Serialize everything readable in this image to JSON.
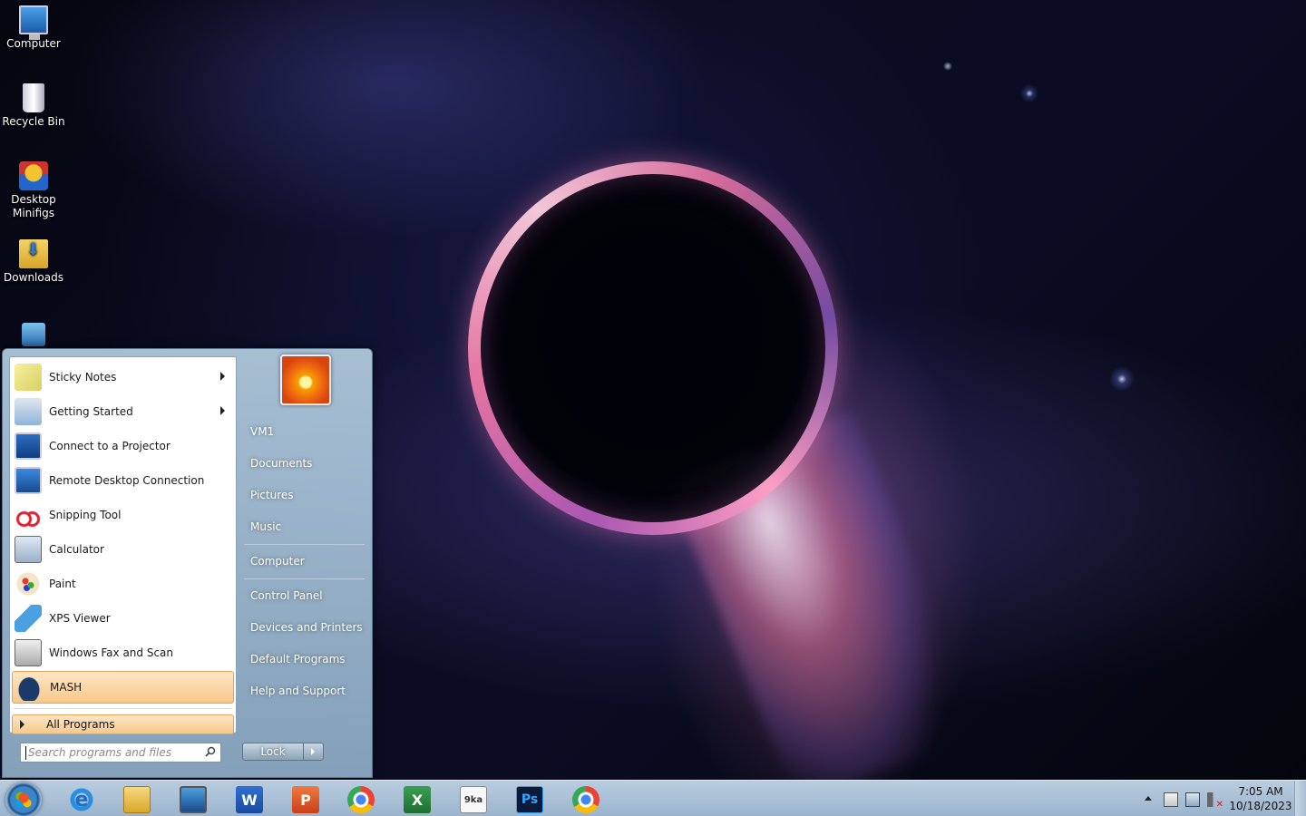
{
  "desktop": {
    "icons": [
      {
        "label": "Computer",
        "icon": "computer-icon"
      },
      {
        "label": "Recycle Bin",
        "icon": "recycle-bin-icon"
      },
      {
        "label": "Desktop Minifigs",
        "icon": "lego-minifig-icon"
      },
      {
        "label": "Downloads",
        "icon": "downloads-folder-icon"
      },
      {
        "label": "",
        "icon": "network-shortcut-icon"
      }
    ]
  },
  "start_menu": {
    "programs": [
      {
        "label": "Sticky Notes",
        "icon": "sticky-notes-icon",
        "has_submenu": true
      },
      {
        "label": "Getting Started",
        "icon": "getting-started-icon",
        "has_submenu": true
      },
      {
        "label": "Connect to a Projector",
        "icon": "projector-icon",
        "has_submenu": false
      },
      {
        "label": "Remote Desktop Connection",
        "icon": "remote-desktop-icon",
        "has_submenu": false
      },
      {
        "label": "Snipping Tool",
        "icon": "snipping-tool-icon",
        "has_submenu": false
      },
      {
        "label": "Calculator",
        "icon": "calculator-icon",
        "has_submenu": false
      },
      {
        "label": "Paint",
        "icon": "paint-icon",
        "has_submenu": false
      },
      {
        "label": "XPS Viewer",
        "icon": "xps-viewer-icon",
        "has_submenu": false
      },
      {
        "label": "Windows Fax and Scan",
        "icon": "fax-scan-icon",
        "has_submenu": false
      },
      {
        "label": "MASH",
        "icon": "mash-icon",
        "has_submenu": false,
        "highlighted": true
      }
    ],
    "all_programs_label": "All Programs",
    "search_placeholder": "Search programs and files",
    "right_items": [
      "VM1",
      "Documents",
      "Pictures",
      "Music",
      "Computer",
      "Control Panel",
      "Devices and Printers",
      "Default Programs",
      "Help and Support"
    ],
    "lock_label": "Lock",
    "user_picture": "flower-avatar"
  },
  "taskbar": {
    "pinned": [
      {
        "name": "internet-explorer",
        "icon": "ie-icon",
        "glyph": "e"
      },
      {
        "name": "windows-explorer",
        "icon": "folder-icon",
        "glyph": ""
      },
      {
        "name": "monitor-app",
        "icon": "monitor-icon",
        "glyph": ""
      },
      {
        "name": "microsoft-word",
        "icon": "word-icon",
        "glyph": "W"
      },
      {
        "name": "microsoft-powerpoint",
        "icon": "powerpoint-icon",
        "glyph": "P"
      },
      {
        "name": "google-chrome",
        "icon": "chrome-icon",
        "glyph": ""
      },
      {
        "name": "microsoft-excel",
        "icon": "excel-icon",
        "glyph": "X"
      },
      {
        "name": "calculator-doc",
        "icon": "calculator-doc-icon",
        "glyph": "9ka"
      },
      {
        "name": "adobe-photoshop",
        "icon": "photoshop-icon",
        "glyph": "Ps"
      },
      {
        "name": "google-chrome-2",
        "icon": "chrome-icon",
        "glyph": ""
      }
    ],
    "clock_time": "7:05 AM",
    "clock_date": "10/18/2023"
  },
  "colors": {
    "highlight_start": "#fde6c6",
    "highlight_end": "#f8c88a",
    "taskbar": "#b9cde0"
  }
}
